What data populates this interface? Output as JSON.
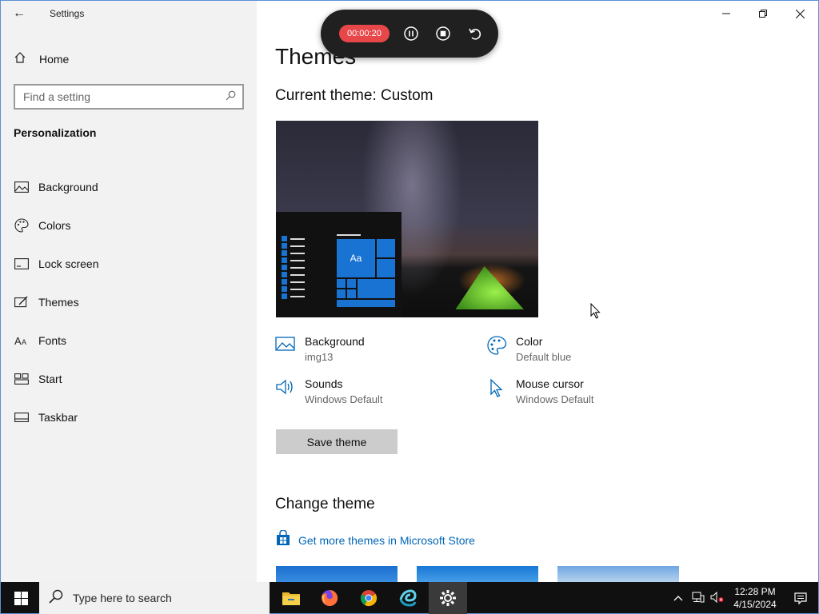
{
  "window": {
    "app_title": "Settings",
    "controls": {
      "minimize": "—",
      "restore": "❐",
      "close": "✕"
    }
  },
  "sidebar": {
    "home_label": "Home",
    "search_placeholder": "Find a setting",
    "section_title": "Personalization",
    "items": [
      {
        "label": "Background",
        "icon": "image-icon"
      },
      {
        "label": "Colors",
        "icon": "palette-icon"
      },
      {
        "label": "Lock screen",
        "icon": "lock-screen-icon"
      },
      {
        "label": "Themes",
        "icon": "themes-icon"
      },
      {
        "label": "Fonts",
        "icon": "fonts-icon"
      },
      {
        "label": "Start",
        "icon": "start-icon"
      },
      {
        "label": "Taskbar",
        "icon": "taskbar-icon"
      }
    ]
  },
  "recorder": {
    "time": "00:00:20"
  },
  "main": {
    "title": "Themes",
    "current_theme": "Current theme: Custom",
    "preview": {
      "tile_label": "Aa"
    },
    "attributes": [
      {
        "name": "Background",
        "value": "img13",
        "icon": "image-icon"
      },
      {
        "name": "Color",
        "value": "Default blue",
        "icon": "palette-icon"
      },
      {
        "name": "Sounds",
        "value": "Windows Default",
        "icon": "speaker-icon"
      },
      {
        "name": "Mouse cursor",
        "value": "Windows Default",
        "icon": "cursor-icon"
      }
    ],
    "save_label": "Save theme",
    "change_title": "Change theme",
    "store_link": "Get more themes in Microsoft Store"
  },
  "taskbar": {
    "search_placeholder": "Type here to search",
    "time": "12:28 PM",
    "date": "4/15/2024"
  },
  "colors": {
    "accent": "#0067b8",
    "tile_blue": "#1873d3",
    "record_red": "#e8474a"
  }
}
